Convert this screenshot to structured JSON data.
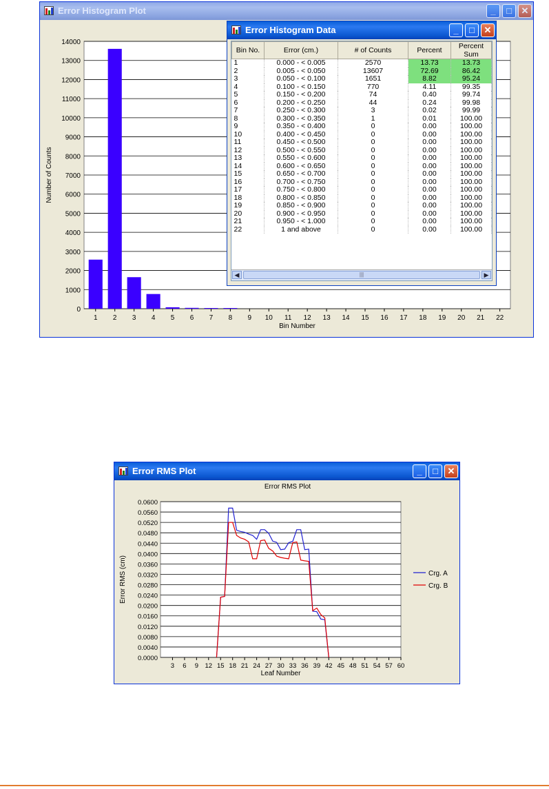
{
  "histogram_window": {
    "title": "Error Histogram Plot",
    "icon": "bar-chart-app-icon",
    "buttons": {
      "minimize": "_",
      "maximize": "□",
      "close": "✕"
    }
  },
  "data_window": {
    "title": "Error Histogram Data",
    "icon": "bar-chart-app-icon",
    "buttons": {
      "minimize": "_",
      "maximize": "□",
      "close": "✕"
    },
    "columns": [
      "Bin No.",
      "Error (cm.)",
      "# of Counts",
      "Percent",
      "Percent Sum"
    ],
    "rows": [
      [
        "1",
        "0.000 - < 0.005",
        "2570",
        "13.73",
        "13.73"
      ],
      [
        "2",
        "0.005 - < 0.050",
        "13607",
        "72.69",
        "86.42"
      ],
      [
        "3",
        "0.050 - < 0.100",
        "1651",
        "8.82",
        "95.24"
      ],
      [
        "4",
        "0.100 - < 0.150",
        "770",
        "4.11",
        "99.35"
      ],
      [
        "5",
        "0.150 - < 0.200",
        "74",
        "0.40",
        "99.74"
      ],
      [
        "6",
        "0.200 - < 0.250",
        "44",
        "0.24",
        "99.98"
      ],
      [
        "7",
        "0.250 - < 0.300",
        "3",
        "0.02",
        "99.99"
      ],
      [
        "8",
        "0.300 - < 0.350",
        "1",
        "0.01",
        "100.00"
      ],
      [
        "9",
        "0.350 - < 0.400",
        "0",
        "0.00",
        "100.00"
      ],
      [
        "10",
        "0.400 - < 0.450",
        "0",
        "0.00",
        "100.00"
      ],
      [
        "11",
        "0.450 - < 0.500",
        "0",
        "0.00",
        "100.00"
      ],
      [
        "12",
        "0.500 - < 0.550",
        "0",
        "0.00",
        "100.00"
      ],
      [
        "13",
        "0.550 - < 0.600",
        "0",
        "0.00",
        "100.00"
      ],
      [
        "14",
        "0.600 - < 0.650",
        "0",
        "0.00",
        "100.00"
      ],
      [
        "15",
        "0.650 - < 0.700",
        "0",
        "0.00",
        "100.00"
      ],
      [
        "16",
        "0.700 - < 0.750",
        "0",
        "0.00",
        "100.00"
      ],
      [
        "17",
        "0.750 - < 0.800",
        "0",
        "0.00",
        "100.00"
      ],
      [
        "18",
        "0.800 - < 0.850",
        "0",
        "0.00",
        "100.00"
      ],
      [
        "19",
        "0.850 - < 0.900",
        "0",
        "0.00",
        "100.00"
      ],
      [
        "20",
        "0.900 - < 0.950",
        "0",
        "0.00",
        "100.00"
      ],
      [
        "21",
        "0.950 - < 1.000",
        "0",
        "0.00",
        "100.00"
      ],
      [
        "22",
        "1 and above",
        "0",
        "0.00",
        "100.00"
      ]
    ],
    "highlighted_rows": [
      0,
      1,
      2
    ],
    "highlight_color": "#7ee07e",
    "scroll": {
      "left": "◀",
      "right": "▶",
      "thumb": "|||"
    }
  },
  "rms_window": {
    "title": "Error RMS Plot",
    "icon": "bar-chart-app-icon",
    "buttons": {
      "minimize": "_",
      "maximize": "□",
      "close": "✕"
    }
  },
  "chart_data": [
    {
      "type": "bar",
      "title": "",
      "xlabel": "Bin Number",
      "ylabel": "Number of Counts",
      "ylim": [
        0,
        14000
      ],
      "yticks": [
        0,
        1000,
        2000,
        3000,
        4000,
        5000,
        6000,
        7000,
        8000,
        9000,
        10000,
        11000,
        12000,
        13000,
        14000
      ],
      "categories": [
        "1",
        "2",
        "3",
        "4",
        "5",
        "6",
        "7",
        "8",
        "9",
        "10",
        "11",
        "12",
        "13",
        "14",
        "15",
        "16",
        "17",
        "18",
        "19",
        "20",
        "21",
        "22"
      ],
      "values": [
        2570,
        13607,
        1651,
        770,
        74,
        44,
        3,
        1,
        0,
        0,
        0,
        0,
        0,
        0,
        0,
        0,
        0,
        0,
        0,
        0,
        0,
        0
      ],
      "bar_color": "#3a00ff",
      "grid": true
    },
    {
      "type": "line",
      "title": "Error RMS Plot",
      "xlabel": "Leaf Number",
      "ylabel": "Error RMS (cm)",
      "xlim": [
        0,
        60
      ],
      "ylim": [
        0,
        0.06
      ],
      "xticks": [
        3,
        6,
        9,
        12,
        15,
        18,
        21,
        24,
        27,
        30,
        33,
        36,
        39,
        42,
        45,
        48,
        51,
        54,
        57,
        60
      ],
      "yticks": [
        "0.0000",
        "0.0040",
        "0.0080",
        "0.0120",
        "0.0160",
        "0.0200",
        "0.0240",
        "0.0280",
        "0.0320",
        "0.0360",
        "0.0400",
        "0.0440",
        "0.0480",
        "0.0520",
        "0.0560",
        "0.0600"
      ],
      "grid": true,
      "legend_placement": "right",
      "series": [
        {
          "name": "Crg. A",
          "color": "#2020d0",
          "points": [
            [
              14,
              0.0
            ],
            [
              15,
              0.0232
            ],
            [
              16,
              0.0235
            ],
            [
              17,
              0.0575
            ],
            [
              18,
              0.0575
            ],
            [
              19,
              0.049
            ],
            [
              20,
              0.0485
            ],
            [
              21,
              0.0482
            ],
            [
              22,
              0.0475
            ],
            [
              23,
              0.047
            ],
            [
              24,
              0.0455
            ],
            [
              25,
              0.0492
            ],
            [
              26,
              0.0492
            ],
            [
              27,
              0.0478
            ],
            [
              28,
              0.0448
            ],
            [
              29,
              0.0443
            ],
            [
              30,
              0.0415
            ],
            [
              31,
              0.0417
            ],
            [
              32,
              0.0442
            ],
            [
              33,
              0.0447
            ],
            [
              34,
              0.0492
            ],
            [
              35,
              0.0492
            ],
            [
              36,
              0.0415
            ],
            [
              37,
              0.0417
            ],
            [
              38,
              0.0178
            ],
            [
              39,
              0.0176
            ],
            [
              40,
              0.0148
            ],
            [
              41,
              0.0145
            ],
            [
              42,
              0.0
            ]
          ]
        },
        {
          "name": "Crg. B",
          "color": "#e00000",
          "points": [
            [
              14,
              0.0
            ],
            [
              15,
              0.0232
            ],
            [
              16,
              0.0235
            ],
            [
              17,
              0.052
            ],
            [
              18,
              0.052
            ],
            [
              19,
              0.047
            ],
            [
              20,
              0.046
            ],
            [
              21,
              0.0455
            ],
            [
              22,
              0.0445
            ],
            [
              23,
              0.038
            ],
            [
              24,
              0.038
            ],
            [
              25,
              0.045
            ],
            [
              26,
              0.0452
            ],
            [
              27,
              0.042
            ],
            [
              28,
              0.041
            ],
            [
              29,
              0.039
            ],
            [
              30,
              0.0385
            ],
            [
              31,
              0.0382
            ],
            [
              32,
              0.038
            ],
            [
              33,
              0.0442
            ],
            [
              34,
              0.0445
            ],
            [
              35,
              0.0375
            ],
            [
              36,
              0.0372
            ],
            [
              37,
              0.037
            ],
            [
              38,
              0.018
            ],
            [
              39,
              0.019
            ],
            [
              40,
              0.0165
            ],
            [
              41,
              0.0152
            ],
            [
              42,
              0.0
            ]
          ]
        }
      ]
    }
  ]
}
